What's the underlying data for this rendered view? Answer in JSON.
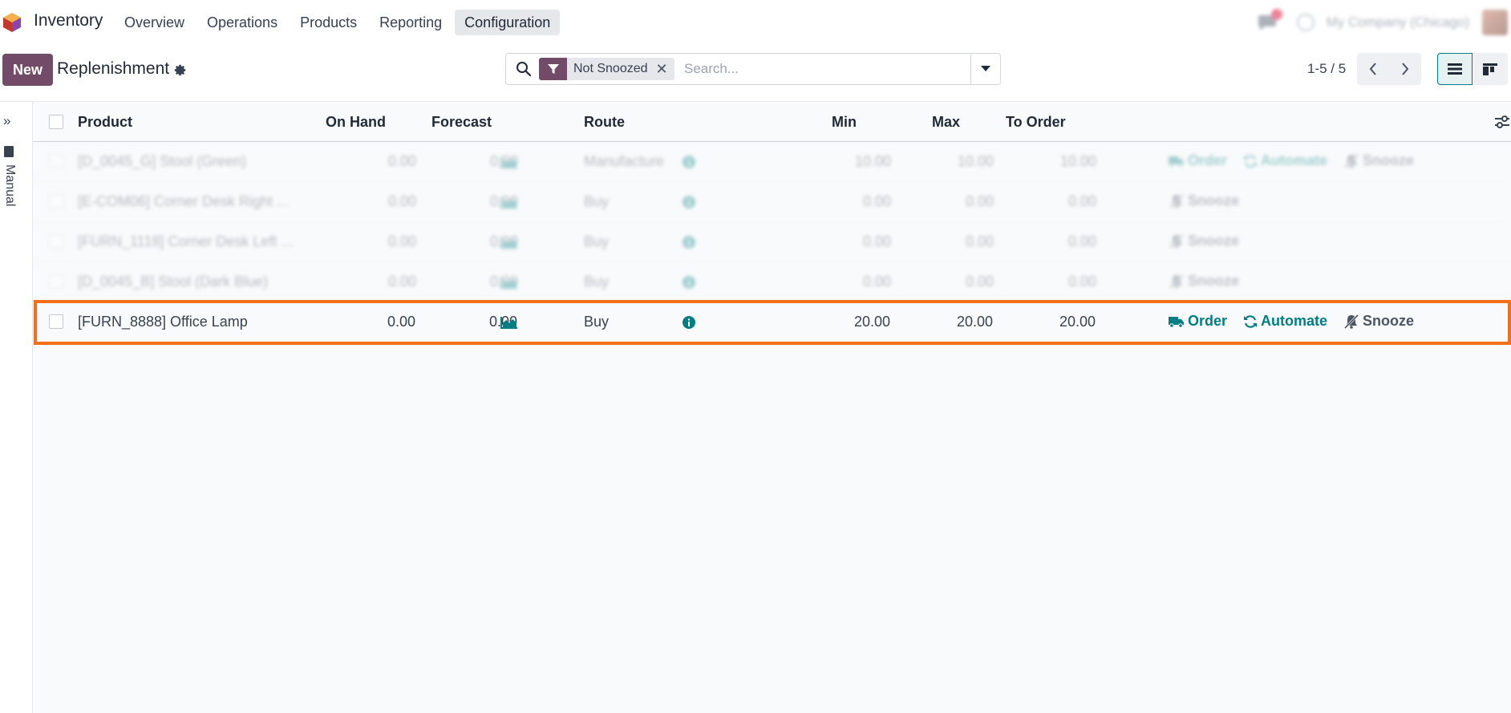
{
  "navbar": {
    "app_name": "Inventory",
    "menu": [
      "Overview",
      "Operations",
      "Products",
      "Reporting",
      "Configuration"
    ],
    "active_menu": "Configuration",
    "company": "My Company (Chicago)"
  },
  "control": {
    "new_label": "New",
    "title": "Replenishment",
    "facet_label": "Not Snoozed",
    "search_placeholder": "Search...",
    "pager": "1-5 / 5"
  },
  "sidepanel": {
    "label": "Manual"
  },
  "list": {
    "columns": [
      "Product",
      "On Hand",
      "Forecast",
      "Route",
      "Min",
      "Max",
      "To Order"
    ],
    "rows": [
      {
        "product": "[D_0045_G] Stool (Green)",
        "on_hand": "0.00",
        "forecast": "0.00",
        "route": "Manufacture",
        "min": "10.00",
        "max": "10.00",
        "to_order": "10.00",
        "actions": [
          "Order",
          "Automate",
          "Snooze"
        ]
      },
      {
        "product": "[E-COM06] Corner Desk Right ...",
        "on_hand": "0.00",
        "forecast": "0.00",
        "route": "Buy",
        "min": "0.00",
        "max": "0.00",
        "to_order": "0.00",
        "actions": [
          "Snooze"
        ]
      },
      {
        "product": "[FURN_1118] Corner Desk Left ...",
        "on_hand": "0.00",
        "forecast": "0.00",
        "route": "Buy",
        "min": "0.00",
        "max": "0.00",
        "to_order": "0.00",
        "actions": [
          "Snooze"
        ]
      },
      {
        "product": "[D_0045_B] Stool (Dark Blue)",
        "on_hand": "0.00",
        "forecast": "0.00",
        "route": "Buy",
        "min": "0.00",
        "max": "0.00",
        "to_order": "0.00",
        "actions": [
          "Snooze"
        ]
      },
      {
        "product": "[FURN_8888] Office Lamp",
        "on_hand": "0.00",
        "forecast": "0.00",
        "route": "Buy",
        "min": "20.00",
        "max": "20.00",
        "to_order": "20.00",
        "actions": [
          "Order",
          "Automate",
          "Snooze"
        ]
      }
    ]
  },
  "colors": {
    "brand": "#714b67",
    "accent": "#017e84",
    "highlight": "#f27017"
  }
}
